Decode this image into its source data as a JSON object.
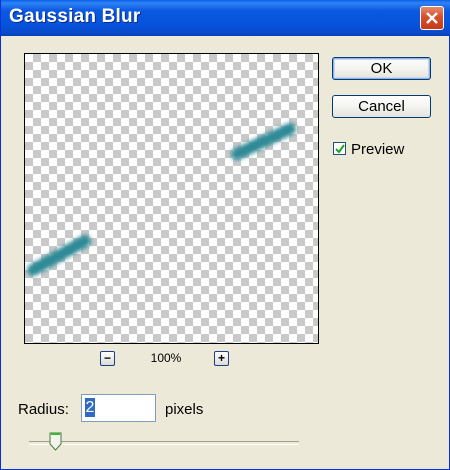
{
  "window": {
    "title": "Gaussian Blur"
  },
  "buttons": {
    "ok_label": "OK",
    "cancel_label": "Cancel"
  },
  "preview_option": {
    "label": "Preview",
    "checked": true
  },
  "zoom": {
    "level": "100%",
    "zoom_out_icon": "minus-icon",
    "zoom_in_icon": "plus-icon",
    "zoom_out_symbol": "−",
    "zoom_in_symbol": "+"
  },
  "radius": {
    "label": "Radius:",
    "value": "2",
    "unit_label": "pixels",
    "slider_fraction": 0.1
  },
  "colors": {
    "titlebar": "#0652dc",
    "dialog_bg": "#ece9d8",
    "stroke": "#2e8a96",
    "selection": "#316ac5"
  }
}
